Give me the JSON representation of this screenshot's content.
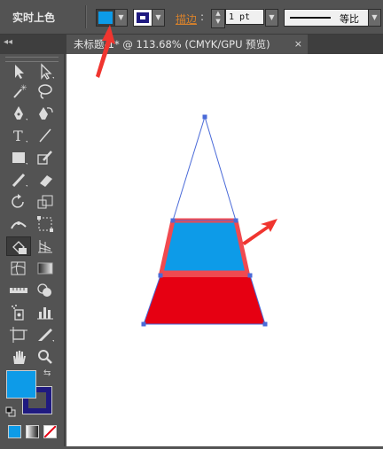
{
  "control_bar": {
    "mode_label": "实时上色",
    "fill_color": "#0d9be8",
    "stroke_color": "#1f1a80",
    "stroke_label": "描边",
    "stroke_weight": "1 pt",
    "stroke_profile": "等比"
  },
  "document_tab": {
    "title": "未标题-1* @ 113.68% (CMYK/GPU 预览)",
    "close": "×"
  },
  "toolbar": {
    "collapse": "◂◂",
    "fill_color": "#0d9be8",
    "stroke_color": "#1f1a80"
  },
  "artwork": {
    "upper_shape_fill": "#0d9be8",
    "upper_shape_stroke": "#f04a50",
    "lower_shape_fill": "#e60012",
    "path_color": "#4a6ad8",
    "annotation_color": "#f0352f"
  }
}
